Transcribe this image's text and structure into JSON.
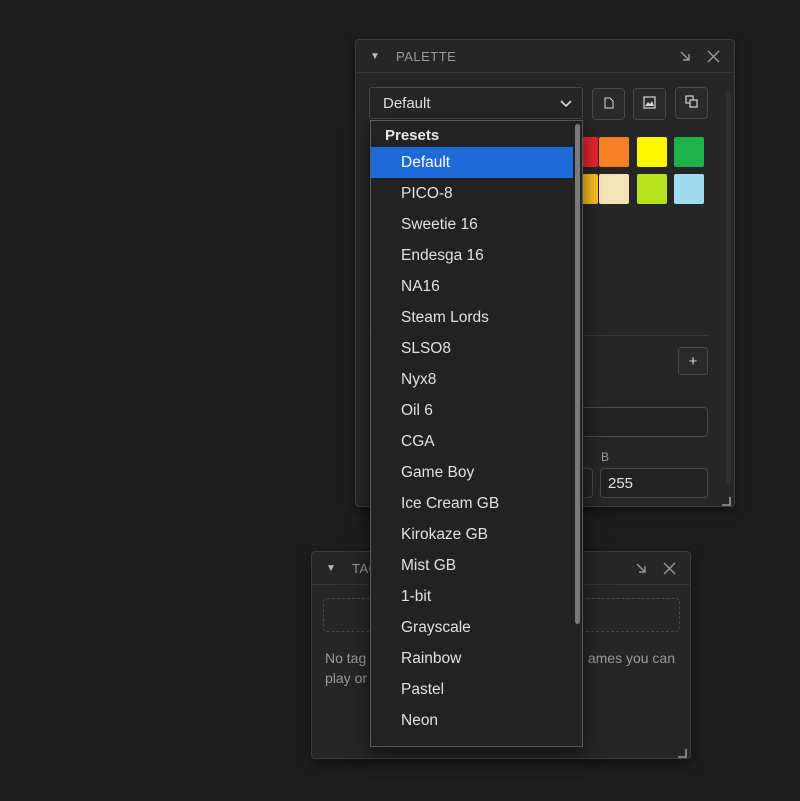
{
  "palette_panel": {
    "title": "PALETTE",
    "selected_preset": "Default",
    "new_button_icon": "document-icon",
    "image_button_icon": "image-icon",
    "copy_button_icon": "duplicate-icon",
    "swatches": [
      {
        "color": "#e3272d"
      },
      {
        "color": "#fb8224"
      },
      {
        "color": "#fff700"
      },
      {
        "color": "#1fb24b"
      },
      {
        "color": "#fdbf24"
      },
      {
        "color": "#f4e3b6"
      },
      {
        "color": "#b7e31d"
      },
      {
        "color": "#9fdcee"
      }
    ],
    "add_label": "+",
    "channel_label": "B",
    "channel_value": "255"
  },
  "tags_panel": {
    "title": "TAGS",
    "title_visible": "TAG",
    "empty_text_left_1": "No tag",
    "empty_text_left_2": "play or",
    "empty_text_right": "ames you can"
  },
  "dropdown": {
    "group_label": "Presets",
    "items": [
      "Default",
      "PICO-8",
      "Sweetie 16",
      "Endesga 16",
      "NA16",
      "Steam Lords",
      "SLSO8",
      "Nyx8",
      "Oil 6",
      "CGA",
      "Game Boy",
      "Ice Cream GB",
      "Kirokaze GB",
      "Mist GB",
      "1-bit",
      "Grayscale",
      "Rainbow",
      "Pastel",
      "Neon"
    ],
    "selected_index": 0
  },
  "colors": {
    "accent": "#1e6ad8",
    "background": "#1e1e1e",
    "panel": "#262626"
  }
}
